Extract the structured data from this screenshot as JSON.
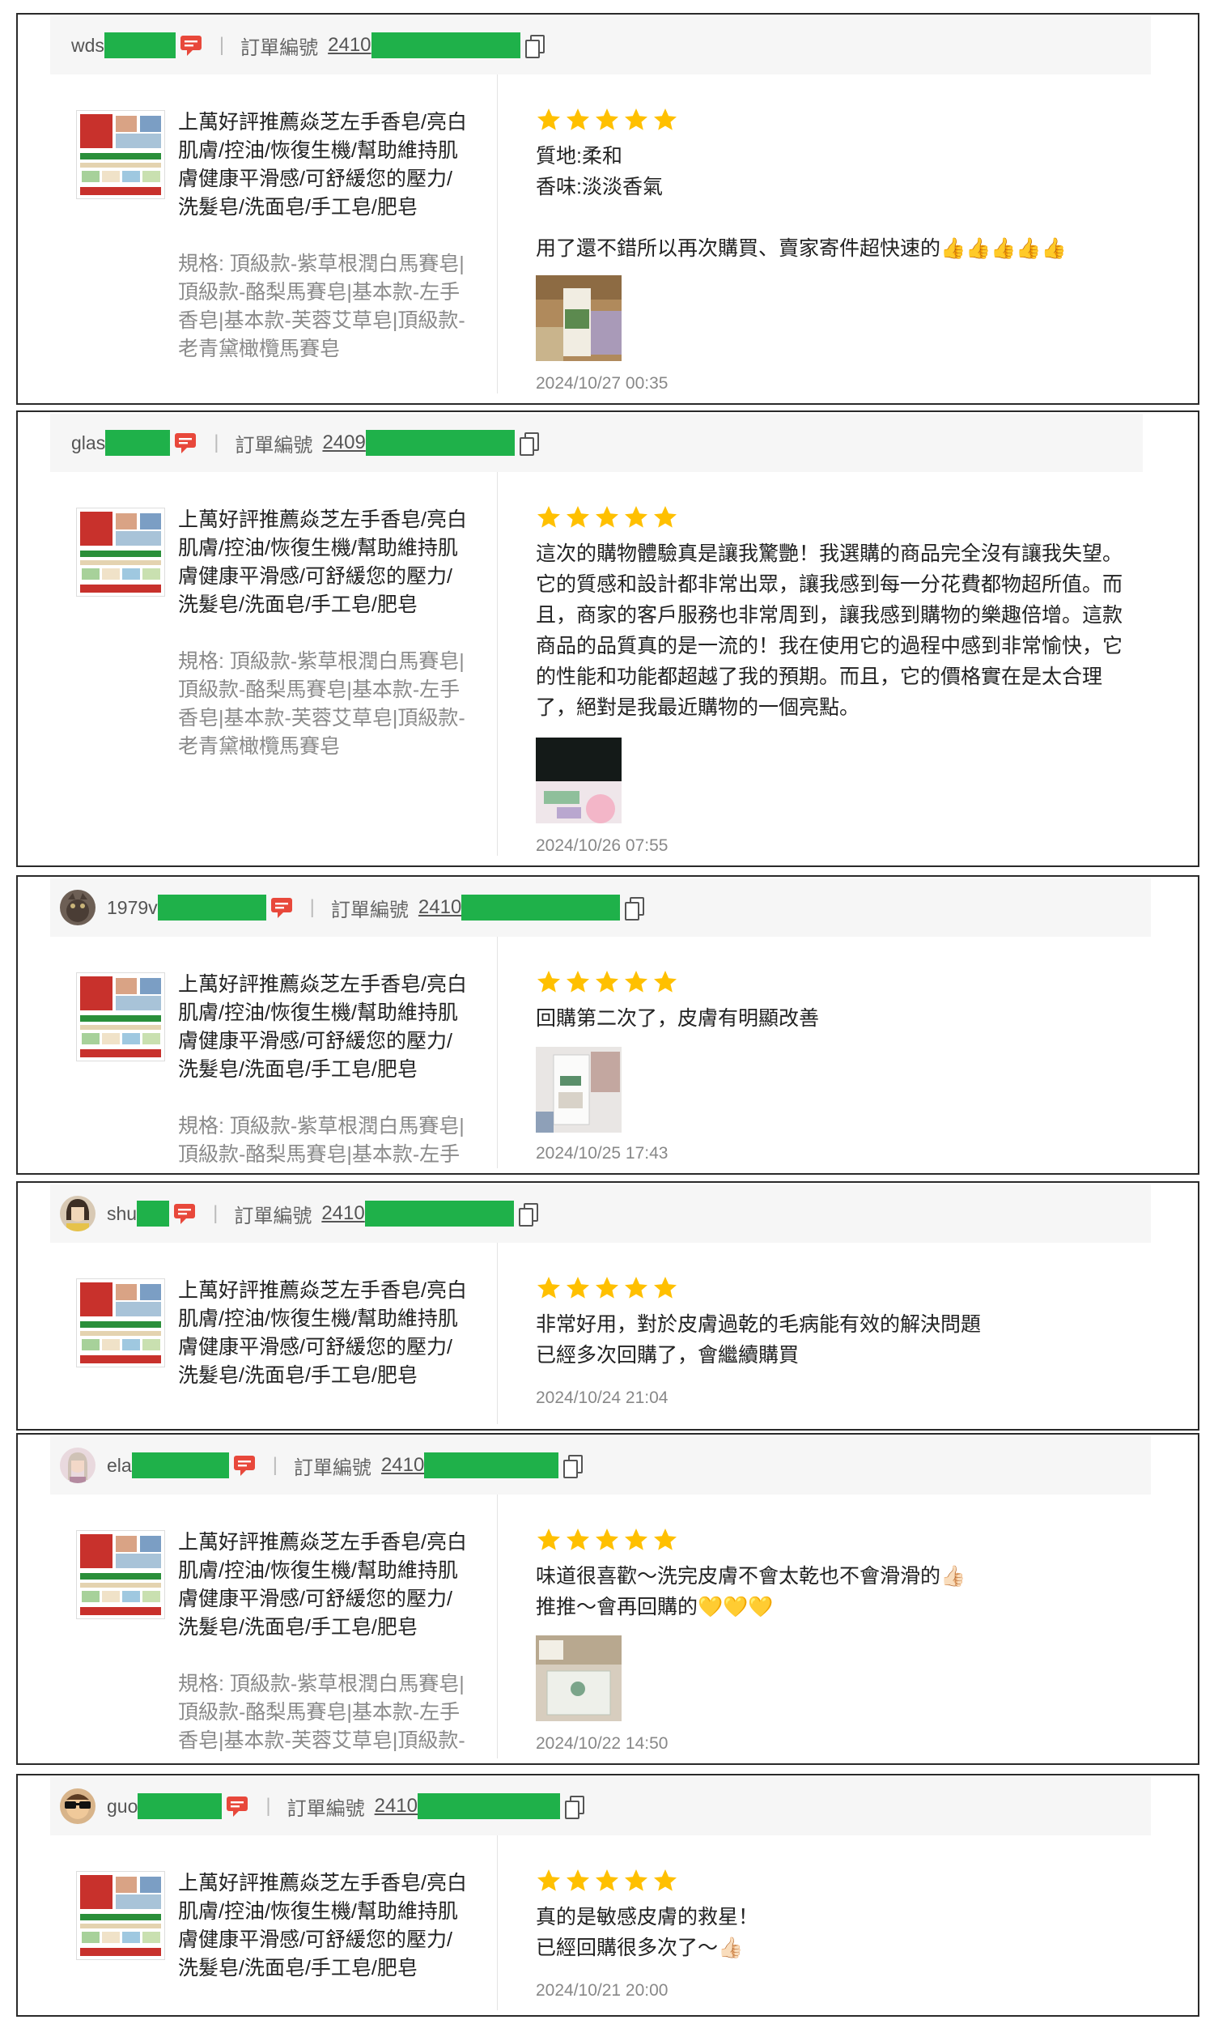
{
  "order_label": "訂單編號",
  "product_name": "上萬好評推薦焱芝左手香皂/亮白肌膚/控油/恢復生機/幫助維持肌膚健康平滑感/可舒緩您的壓力/洗髮皂/洗面皂/手工皂/肥皂",
  "product_spec": "規格: 頂級款-紫草根潤白馬賽皂|頂級款-酪梨馬賽皂|基本款-左手香皂|基本款-芙蓉艾草皂|頂級款-老青黛橄欖馬賽皂",
  "colors": {
    "star": "#ffc000",
    "mask": "#1fb14a",
    "chat_icon": "#e8483b"
  },
  "reviews": [
    {
      "user": "wds",
      "order_no": "2410",
      "rating": 5,
      "comment": "質地:柔和\n香味:淡淡香氣\n\n用了還不錯所以再次購買、賣家寄件超快速的👍👍👍👍👍",
      "date": "2024/10/27 00:35"
    },
    {
      "user": "glas",
      "order_no": "2409",
      "rating": 5,
      "comment": "這次的購物體驗真是讓我驚艷！我選購的商品完全沒有讓我失望。它的質感和設計都非常出眾，讓我感到每一分花費都物超所值。而且，商家的客戶服務也非常周到，讓我感到購物的樂趣倍增。這款商品的品質真的是一流的！我在使用它的過程中感到非常愉快，它的性能和功能都超越了我的預期。而且，它的價格實在是太合理了，絕對是我最近購物的一個亮點。",
      "date": "2024/10/26 07:55"
    },
    {
      "user": "1979v",
      "order_no": "2410",
      "rating": 5,
      "comment": "回購第二次了，皮膚有明顯改善",
      "date": "2024/10/25 17:43"
    },
    {
      "user": "shu",
      "order_no": "2410",
      "rating": 5,
      "comment": "非常好用，對於皮膚過乾的毛病能有效的解決問題\n已經多次回購了，會繼續購買",
      "date": "2024/10/24 21:04"
    },
    {
      "user": "ela",
      "order_no": "2410",
      "rating": 5,
      "comment": "味道很喜歡～洗完皮膚不會太乾也不會滑滑的👍🏻\n推推～會再回購的💛💛💛",
      "date": "2024/10/22 14:50"
    },
    {
      "user": "guo",
      "order_no": "2410",
      "rating": 5,
      "comment": "真的是敏感皮膚的救星！\n已經回購很多次了～👍🏻",
      "date": "2024/10/21 20:00"
    }
  ]
}
